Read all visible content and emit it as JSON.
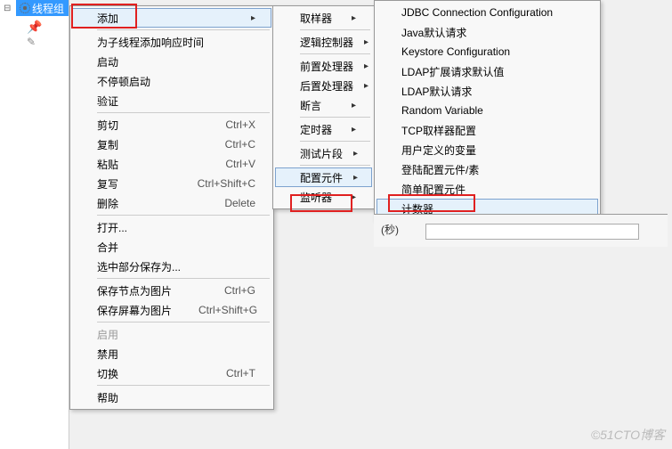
{
  "tree": {
    "node_label": "线程组"
  },
  "menu1": {
    "add": "添加",
    "add_timer": "为子线程添加响应时间",
    "start": "启动",
    "start_no_pause": "不停顿启动",
    "validate": "验证",
    "cut": "剪切",
    "cut_sc": "Ctrl+X",
    "copy": "复制",
    "copy_sc": "Ctrl+C",
    "paste": "粘贴",
    "paste_sc": "Ctrl+V",
    "duplicate": "复写",
    "duplicate_sc": "Ctrl+Shift+C",
    "delete": "删除",
    "delete_sc": "Delete",
    "open": "打开...",
    "merge": "合并",
    "save_sel": "选中部分保存为...",
    "save_node_img": "保存节点为图片",
    "save_node_img_sc": "Ctrl+G",
    "save_screen_img": "保存屏幕为图片",
    "save_screen_img_sc": "Ctrl+Shift+G",
    "enable": "启用",
    "disable": "禁用",
    "toggle": "切换",
    "toggle_sc": "Ctrl+T",
    "help": "帮助"
  },
  "menu2": {
    "sampler": "取样器",
    "logic": "逻辑控制器",
    "pre": "前置处理器",
    "post": "后置处理器",
    "assert": "断言",
    "timer": "定时器",
    "fragment": "测试片段",
    "config": "配置元件",
    "listener": "监听器"
  },
  "menu3": {
    "jdbc": "JDBC Connection Configuration",
    "java_defaults": "Java默认请求",
    "keystore": "Keystore Configuration",
    "ldap_ext": "LDAP扩展请求默认值",
    "ldap": "LDAP默认请求",
    "random": "Random Variable",
    "tcp": "TCP取样器配置",
    "user_vars": "用户定义的变量",
    "login": "登陆配置元件/素",
    "simple": "简单配置元件",
    "counter": "计数器"
  },
  "panel": {
    "seconds_label": "(秒)"
  },
  "watermark": "©51CTO博客"
}
